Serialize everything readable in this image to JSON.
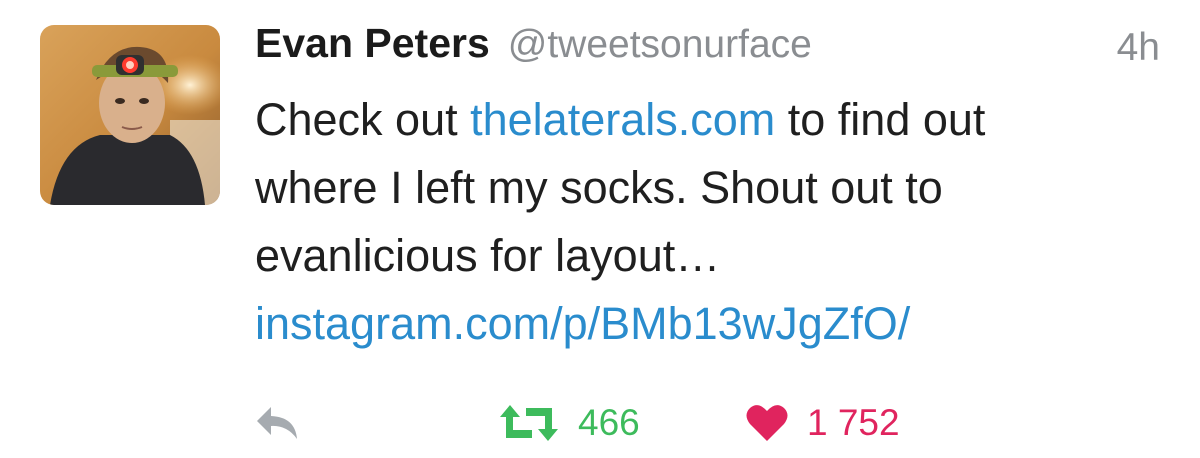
{
  "tweet": {
    "author_name": "Evan Peters",
    "author_handle": "@tweetsonurface",
    "timestamp": "4h",
    "text": {
      "line1_prefix": "Check out ",
      "line1_link": "thelaterals.com",
      "line1_suffix": " to find out",
      "line2": "where I left my socks. Shout out to",
      "line3": "evanlicious for layout…",
      "line4_link": "instagram.com/p/BMb13wJgZfO/"
    },
    "actions": {
      "reply_icon": "reply-icon",
      "retweet_icon": "retweet-icon",
      "retweet_count": "466",
      "like_icon": "heart-icon",
      "like_count": "1 752"
    }
  },
  "colors": {
    "link": "#2a8ccd",
    "retweet": "#3dbb5c",
    "like": "#e0245e",
    "muted": "#8a8d91"
  }
}
